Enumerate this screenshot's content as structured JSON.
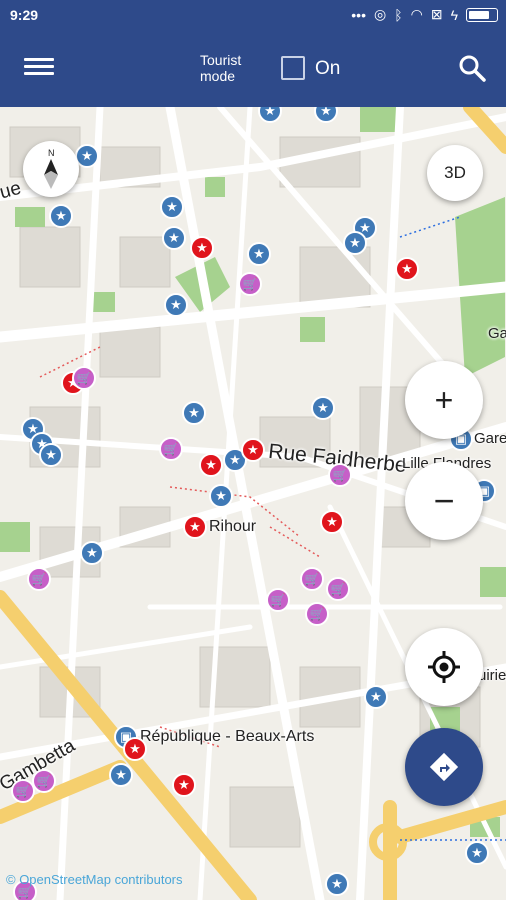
{
  "status_bar": {
    "time": "9:29"
  },
  "app_bar": {
    "tourist_mode_label": "Tourist mode",
    "toggle_label": "On",
    "toggle_checked": false
  },
  "map": {
    "labels": {
      "rue_faidherbe": "Rue Faidherbe",
      "lille_flandres": "Lille Flandres",
      "rihour": "Rihour",
      "republique": "République - Beaux-Arts",
      "gambetta": "Gambetta",
      "gare": "Gare",
      "rue_left": "ue",
      "ga_right": "Ga",
      "rue_right_bottom": "uirie"
    },
    "controls": {
      "three_d": "3D",
      "zoom_in": "+",
      "zoom_out": "−",
      "compass_n": "N"
    },
    "attribution": "© OpenStreetMap contributors"
  },
  "colors": {
    "appbar": "#2e4a8a",
    "poi_blue": "#3f79b6",
    "poi_red": "#e0141c",
    "poi_pink": "#c65fc8",
    "route_fab": "#2e4a8a"
  }
}
